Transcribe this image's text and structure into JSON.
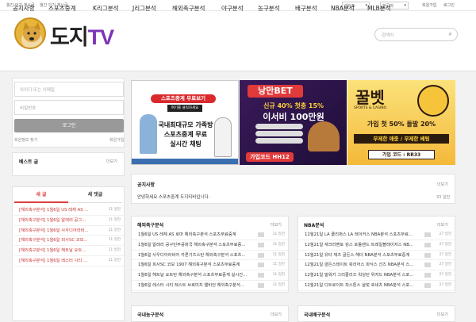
{
  "topbar": {
    "links": [
      "월간 인기 게시글",
      "월간 인기 게시글"
    ],
    "theme": "라이트",
    "lang": "한국어",
    "signup": "회원가입",
    "login": "로그인"
  },
  "logo": {
    "text_a": "도지",
    "text_b": "TV"
  },
  "search": {
    "placeholder": "검색어"
  },
  "nav": [
    "공지사항",
    "스포츠중계",
    "K리그분석",
    "J리그분석",
    "해외축구분석",
    "야구분석",
    "농구분석",
    "배구분석",
    "NBA분석",
    "MLB분석"
  ],
  "login": {
    "id_placeholder": "아이디 또는 이메일",
    "pw_placeholder": "비밀번호",
    "button": "로그인",
    "find": "회원정보 찾기",
    "join": "회원가입"
  },
  "best": {
    "title": "베스트 글",
    "more": "더보기"
  },
  "recent": {
    "tab_new": "새 글",
    "tab_comment": "새 댓글",
    "rows": [
      {
        "text": "[해외축구분석] 1월6일 US 레체 AS ...",
        "meta": "11 일전"
      },
      {
        "text": "[해외축구분석] 1월6일 알레리 공그...",
        "meta": "11 일전"
      },
      {
        "text": "[해외축구분석] 1월6일 사우디아라비...",
        "meta": "11 일전"
      },
      {
        "text": "[해외축구분석] 1월6일 피사SC 코모...",
        "meta": "11 일전"
      },
      {
        "text": "[해외축구분석] 1월6일 헤트날 요트...",
        "meta": "11 일전"
      },
      {
        "text": "[해외축구분석] 1월6일 레스터 시티 ...",
        "meta": "11 일전"
      }
    ]
  },
  "banners": [
    {
      "title": "스포츠중계 무료보기",
      "sub": "여기를 클릭하세요",
      "lines": [
        "국내최대규모 가족방",
        "스포츠중계 무료",
        "실시간 채팅"
      ]
    },
    {
      "brand": "낭만BET",
      "lines": [
        "신규 40% 첫충 15%",
        "이서비 100만원"
      ],
      "code": "가입코드 HH12"
    },
    {
      "brand": "꿀벳",
      "sub": "SPORTS & CASINO",
      "lines": [
        "가입 첫 50% 돌발 20%",
        "무제한 매충 / 무제한 베팅"
      ],
      "code": "가입 코드 : RR33"
    }
  ],
  "notice": {
    "title": "공지사항",
    "more": "더보기",
    "text": "안녕하세요 스포츠중계 도지티비입니다.",
    "meta": "33 일전"
  },
  "foreign": {
    "title": "해외축구분석",
    "more": "더보기",
    "rows": [
      {
        "text": "1월6일 US 레체 AS 로마 해외축구분석 스포츠무료중계",
        "meta": "11 일전"
      },
      {
        "text": "1월6일 알레리 공구민주공화국 해외축구분석 스포츠무료중...",
        "meta": "11 일전"
      },
      {
        "text": "1월6일 사우디아라비아 카론기즈스탄 해외축구분석 스포츠...",
        "meta": "11 일전"
      },
      {
        "text": "1월6일 피사SC 코모 1907 해외축구분석 스포츠무료중계",
        "meta": "11 일전"
      },
      {
        "text": "1월6일 헤트날 요트탄 해외축구분석 스포츠무료중계 실시간...",
        "meta": "11 일전"
      },
      {
        "text": "1월6일 레스터 시티 레스트 브로미치 앨비언 해외축구분석...",
        "meta": "11 일전"
      }
    ]
  },
  "nba": {
    "title": "NBA분석",
    "more": "더보기",
    "rows": [
      {
        "text": "12월21일 LA 클리퍼스 LA 레이커스 NBA분석 스포츠무료...",
        "meta": "27 일전"
      },
      {
        "text": "12월21일 새크라멘토 킹스 포틀랜드 트레일블레이저스 NB...",
        "meta": "27 일전"
      },
      {
        "text": "12월21일 유타 재즈 골든스 헤더 NBA분석 스포츠무료중계",
        "meta": "27 일전"
      },
      {
        "text": "12월21일 골든스테이트 워리어스 피닉스 선즈 NBA분석 스...",
        "meta": "27 일전"
      },
      {
        "text": "12월21일 밀워키 그리즐리즈 워싱턴 위저드 NBA분석 스포...",
        "meta": "27 일전"
      },
      {
        "text": "12월21일 디트로이트 피스톤스 샬럿 호네츠 NBA분석 스포...",
        "meta": "27 일전"
      }
    ]
  },
  "bottom": [
    {
      "title": "국내농구분석",
      "more": "더보기"
    },
    {
      "title": "국내배구분석",
      "more": "더보기"
    }
  ]
}
